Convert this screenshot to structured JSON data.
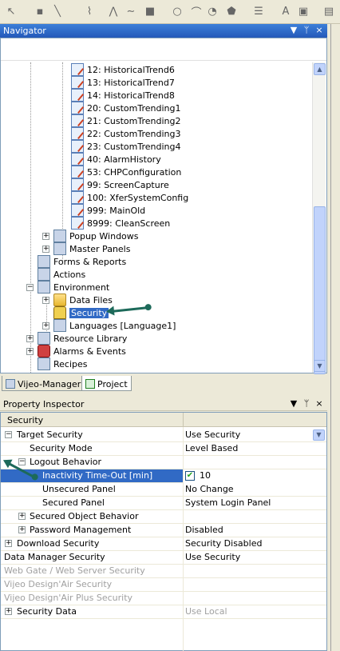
{
  "navigator": {
    "title": "Navigator",
    "tree": [
      {
        "label": "12: HistoricalTrend6"
      },
      {
        "label": "13: HistoricalTrend7"
      },
      {
        "label": "14: HistoricalTrend8"
      },
      {
        "label": "20: CustomTrending1"
      },
      {
        "label": "21: CustomTrending2"
      },
      {
        "label": "22: CustomTrending3"
      },
      {
        "label": "23: CustomTrending4"
      },
      {
        "label": "40: AlarmHistory"
      },
      {
        "label": "53: CHPConfiguration"
      },
      {
        "label": "99: ScreenCapture"
      },
      {
        "label": "100: XferSystemConfig"
      },
      {
        "label": "999: MainOld"
      },
      {
        "label": "8999: CleanScreen"
      },
      {
        "label": "Popup Windows"
      },
      {
        "label": "Master Panels"
      },
      {
        "label": "Forms & Reports"
      },
      {
        "label": "Actions"
      },
      {
        "label": "Environment"
      },
      {
        "label": "Data Files"
      },
      {
        "label": "Security"
      },
      {
        "label": "Languages [Language1]"
      },
      {
        "label": "Resource Library"
      },
      {
        "label": "Alarms & Events"
      },
      {
        "label": "Recipes"
      }
    ],
    "tabs": [
      {
        "label": "Vijeo-Manager"
      },
      {
        "label": "Project"
      }
    ]
  },
  "property_inspector": {
    "title": "Property Inspector",
    "object": "Security",
    "rows": [
      {
        "name": "Target Security",
        "value": "Use Security"
      },
      {
        "name": "Security Mode",
        "value": "Level Based"
      },
      {
        "name": "Logout Behavior",
        "value": ""
      },
      {
        "name": "Inactivity Time-Out [min]",
        "value": "10"
      },
      {
        "name": "Unsecured Panel",
        "value": "No Change"
      },
      {
        "name": "Secured Panel",
        "value": "System Login Panel"
      },
      {
        "name": "Secured Object Behavior",
        "value": ""
      },
      {
        "name": "Password Management",
        "value": "Disabled"
      },
      {
        "name": "Download Security",
        "value": "Security Disabled"
      },
      {
        "name": "Data Manager Security",
        "value": "Use Security"
      },
      {
        "name": "Web Gate / Web Server Security",
        "value": ""
      },
      {
        "name": "Vijeo Design'Air Security",
        "value": ""
      },
      {
        "name": "Vijeo Design'Air Plus Security",
        "value": ""
      },
      {
        "name": "Security Data",
        "value": "Use Local"
      }
    ]
  },
  "glyphs": {
    "pin": "̧",
    "close": "×",
    "dropdown": "▼",
    "up": "▲",
    "down": "▼",
    "plus": "+",
    "minus": "−",
    "check": "✔"
  },
  "colors": {
    "title_bar": "#2459b9",
    "selection": "#316ac5",
    "annotation_arrow": "#1d6a5a"
  }
}
